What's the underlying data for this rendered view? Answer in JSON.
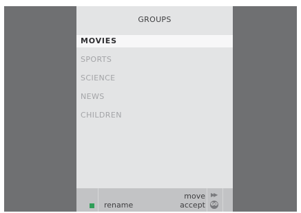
{
  "screen": {
    "title": "GROUPS",
    "items": [
      {
        "label": "MOVIES",
        "selected": true
      },
      {
        "label": "SPORTS",
        "selected": false
      },
      {
        "label": "SCIENCE",
        "selected": false
      },
      {
        "label": "NEWS",
        "selected": false
      },
      {
        "label": "CHILDREN",
        "selected": false
      }
    ]
  },
  "softkeys": {
    "green_label": "rename",
    "move_label": "move",
    "accept_label": "accept",
    "move_icon": "fast-forward-icon",
    "accept_icon": "go-icon",
    "go_glyph": "GO"
  },
  "colors": {
    "frame": "#6f7072",
    "panel": "#e3e4e5",
    "highlight": "#f7f7f8",
    "green_key": "#2f9e58"
  }
}
